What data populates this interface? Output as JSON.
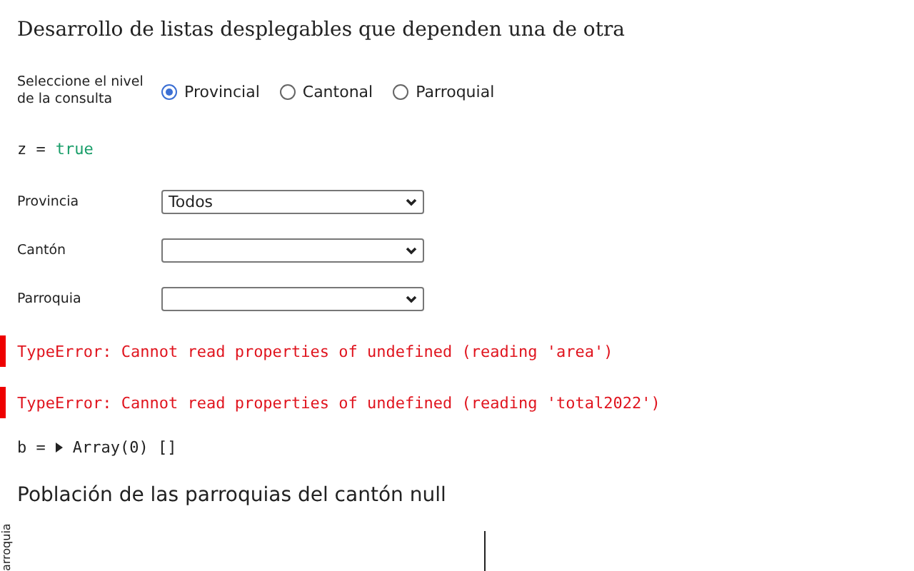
{
  "title": "Desarrollo de listas desplegables que dependen una de otra",
  "level_picker": {
    "label": "Seleccione el nivel de la consulta",
    "options": [
      {
        "label": "Provincial",
        "selected": true
      },
      {
        "label": "Cantonal",
        "selected": false
      },
      {
        "label": "Parroquial",
        "selected": false
      }
    ]
  },
  "z_cell": {
    "name": "z",
    "operator": "=",
    "value": "true"
  },
  "selects": [
    {
      "label": "Provincia",
      "value": "Todos"
    },
    {
      "label": "Cantón"
    },
    {
      "label": "Parroquia"
    }
  ],
  "errors": [
    "TypeError: Cannot read properties of undefined (reading 'area')",
    "TypeError: Cannot read properties of undefined (reading 'total2022')"
  ],
  "b_cell": {
    "name": "b",
    "operator": "=",
    "value": "Array(0) []"
  },
  "chart_heading": "Población de las parroquias del cantón null",
  "chart": {
    "ylabel": "arroquia"
  }
}
